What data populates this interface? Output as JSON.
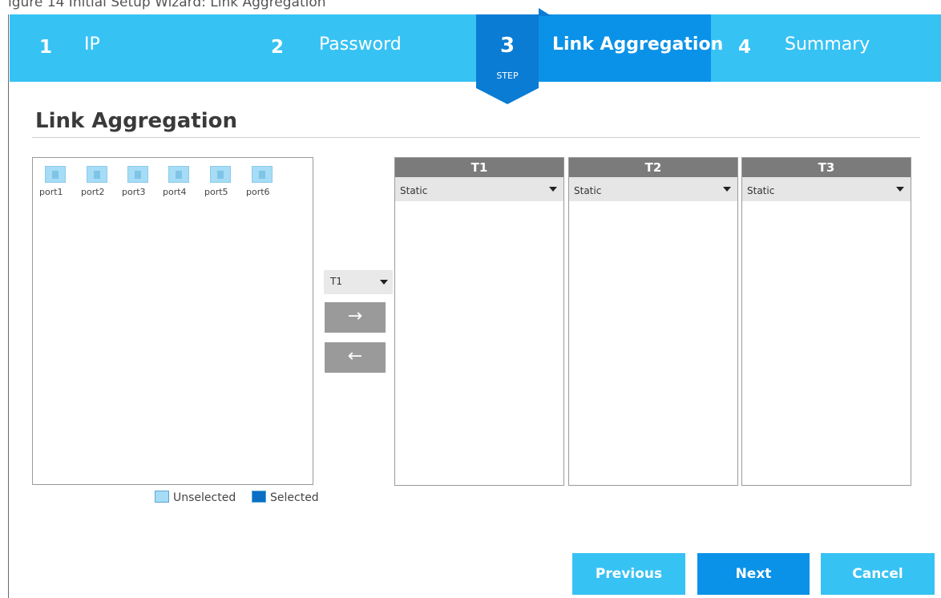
{
  "figure_caption_partial": "igure 14   Initial Setup Wizard: Link Aggregation",
  "wizard": {
    "steps": [
      {
        "number": "1",
        "label": "IP"
      },
      {
        "number": "2",
        "label": "Password"
      },
      {
        "number": "3",
        "label": "Link Aggregation",
        "marker": "STEP",
        "active": true
      },
      {
        "number": "4",
        "label": "Summary"
      }
    ]
  },
  "page": {
    "title": "Link Aggregation"
  },
  "ports": [
    {
      "label": "port1",
      "state": "unselected"
    },
    {
      "label": "port2",
      "state": "unselected"
    },
    {
      "label": "port3",
      "state": "unselected"
    },
    {
      "label": "port4",
      "state": "unselected"
    },
    {
      "label": "port5",
      "state": "unselected"
    },
    {
      "label": "port6",
      "state": "unselected"
    }
  ],
  "legend": {
    "unselected": "Unselected",
    "selected": "Selected"
  },
  "controls": {
    "trunk_select": "T1",
    "move_right": "→",
    "move_left": "←"
  },
  "trunks": [
    {
      "name": "T1",
      "mode": "Static"
    },
    {
      "name": "T2",
      "mode": "Static"
    },
    {
      "name": "T3",
      "mode": "Static"
    }
  ],
  "buttons": {
    "previous": "Previous",
    "next": "Next",
    "cancel": "Cancel"
  },
  "colors": {
    "step_bar": "#37c2f4",
    "step_active": "#0a92e8",
    "step_pin": "#0a7cd4",
    "trunk_header": "#7b7b7b",
    "arrow_button": "#9a9a9a"
  }
}
